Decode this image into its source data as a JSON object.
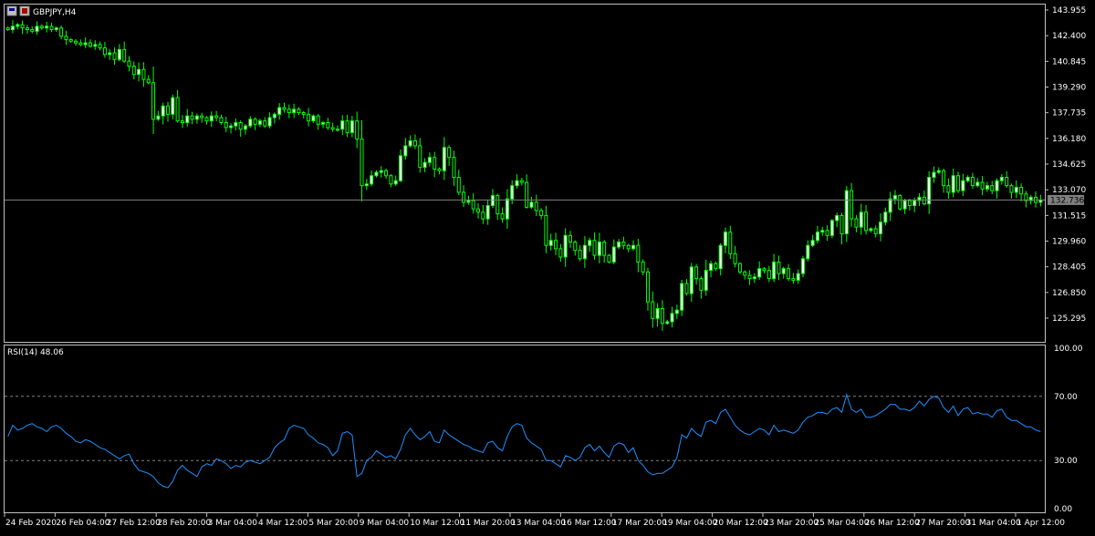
{
  "window": {
    "symbol_label": "GBPJPY,H4",
    "icons": [
      "chart-window-icon",
      "restore-window-icon"
    ]
  },
  "colors": {
    "background": "#000000",
    "frame": "#c0c0c0",
    "bull": "#00ff00",
    "bear": "#ffffff",
    "wick": "#00ff00",
    "rsi_line": "#1e90ff",
    "level_line": "#808080",
    "price_line": "#808080",
    "price_box_bg": "#808080",
    "text": "#ffffff"
  },
  "chart_data": [
    {
      "type": "candlestick",
      "name": "price",
      "title": "GBPJPY,H4",
      "ylim": [
        124.3,
        144.4
      ],
      "price_ticks": [
        "143.955",
        "142.400",
        "140.845",
        "139.290",
        "137.735",
        "136.180",
        "134.625",
        "133.070",
        "131.515",
        "129.960",
        "128.405",
        "126.850",
        "125.295"
      ],
      "current_price": "132.736",
      "current_price_value": 132.736,
      "grid": false,
      "series": [
        {
          "name": "",
          "close": [
            143.0,
            143.2,
            143.3,
            143.1,
            143.0,
            142.9,
            143.2,
            143.1,
            143.2,
            143.0,
            143.1,
            142.6,
            142.4,
            142.3,
            142.2,
            142.1,
            142.2,
            142.0,
            142.1,
            141.9,
            141.5,
            141.6,
            141.2,
            141.8,
            141.1,
            140.8,
            140.3,
            140.6,
            140.0,
            139.8,
            137.6,
            137.8,
            138.4,
            137.9,
            138.9,
            137.5,
            137.4,
            137.8,
            137.6,
            137.8,
            137.7,
            137.5,
            137.8,
            137.7,
            137.4,
            137.1,
            137.2,
            137.4,
            137.0,
            137.2,
            137.6,
            137.3,
            137.5,
            137.2,
            137.7,
            137.9,
            138.3,
            138.2,
            138.0,
            138.2,
            138.0,
            137.9,
            137.5,
            137.8,
            137.3,
            137.4,
            137.1,
            137.0,
            137.0,
            137.5,
            136.8,
            137.5,
            136.4,
            133.6,
            133.7,
            134.2,
            134.4,
            134.5,
            134.2,
            133.7,
            133.9,
            135.4,
            136.0,
            136.3,
            136.0,
            134.7,
            135.0,
            135.3,
            134.6,
            134.5,
            135.9,
            135.3,
            134.1,
            133.2,
            132.6,
            132.7,
            132.2,
            132.0,
            131.6,
            132.4,
            133.0,
            131.9,
            131.6,
            132.8,
            133.6,
            133.9,
            133.8,
            132.3,
            132.6,
            132.1,
            131.8,
            130.0,
            130.3,
            129.8,
            129.3,
            130.6,
            130.2,
            129.7,
            129.2,
            130.0,
            130.3,
            129.4,
            130.2,
            129.4,
            129.0,
            129.9,
            130.2,
            130.0,
            129.8,
            130.0,
            129.0,
            128.4,
            126.6,
            125.6,
            126.2,
            125.3,
            125.4,
            125.9,
            126.1,
            127.7,
            127.1,
            128.7,
            128.0,
            127.3,
            128.5,
            128.9,
            128.6,
            130.0,
            130.8,
            129.5,
            128.9,
            128.4,
            128.2,
            128.0,
            128.1,
            128.6,
            128.5,
            128.0,
            129.0,
            128.3,
            128.6,
            128.0,
            127.9,
            128.3,
            129.2,
            130.0,
            130.3,
            130.8,
            130.9,
            130.6,
            131.5,
            131.8,
            130.7,
            133.3,
            131.6,
            131.1,
            132.0,
            130.9,
            131.0,
            130.7,
            131.4,
            132.0,
            132.8,
            133.0,
            132.2,
            132.7,
            132.4,
            132.7,
            132.9,
            132.5,
            134.1,
            134.4,
            134.5,
            133.6,
            133.2,
            134.2,
            133.3,
            133.9,
            134.1,
            133.6,
            133.8,
            133.4,
            133.6,
            133.3,
            133.9,
            134.1,
            133.6,
            133.2,
            133.5,
            133.1,
            132.7,
            132.9,
            132.6,
            132.74
          ]
        }
      ],
      "note_ohlc": "open/high/low derived in script from close series"
    },
    {
      "type": "line",
      "name": "rsi",
      "title": "RSI(14) 48.06",
      "ylim": [
        0,
        100
      ],
      "y_ticks": [
        "100.00",
        "70.00",
        "30.00",
        "0.00"
      ],
      "levels": [
        70,
        30
      ],
      "series": [
        {
          "name": "RSI(14)",
          "values": [
            45,
            52,
            49,
            50,
            52,
            53,
            51,
            50,
            48,
            51,
            52,
            50,
            47,
            45,
            42,
            41,
            43,
            42,
            40,
            38,
            37,
            35,
            33,
            31,
            33,
            34,
            28,
            24,
            23,
            22,
            20,
            16,
            14,
            13,
            17,
            24,
            27,
            24,
            22,
            20,
            26,
            28,
            27,
            31,
            30,
            28,
            25,
            27,
            26,
            29,
            30,
            29,
            28,
            30,
            32,
            38,
            41,
            43,
            50,
            52,
            51,
            50,
            46,
            44,
            41,
            40,
            38,
            33,
            36,
            47,
            48,
            46,
            20,
            22,
            30,
            32,
            36,
            34,
            32,
            33,
            31,
            37,
            46,
            50,
            46,
            43,
            45,
            48,
            42,
            41,
            49,
            46,
            44,
            42,
            40,
            39,
            37,
            36,
            35,
            41,
            42,
            38,
            36,
            45,
            51,
            53,
            52,
            44,
            41,
            39,
            37,
            30,
            30,
            28,
            26,
            33,
            32,
            30,
            32,
            38,
            40,
            36,
            39,
            35,
            32,
            39,
            41,
            40,
            35,
            38,
            30,
            27,
            23,
            21,
            22,
            22,
            24,
            26,
            32,
            46,
            44,
            50,
            47,
            45,
            54,
            55,
            53,
            60,
            62,
            57,
            52,
            49,
            47,
            46,
            48,
            50,
            49,
            46,
            52,
            48,
            49,
            48,
            47,
            49,
            54,
            57,
            58,
            60,
            60,
            59,
            62,
            63,
            60,
            71,
            62,
            60,
            62,
            57,
            57,
            58,
            60,
            62,
            65,
            65,
            62,
            62,
            61,
            63,
            67,
            64,
            68,
            70,
            69,
            63,
            60,
            64,
            58,
            62,
            63,
            59,
            60,
            59,
            59,
            57,
            61,
            62,
            57,
            55,
            55,
            53,
            51,
            51,
            49,
            48.06
          ]
        }
      ]
    }
  ],
  "time_axis": {
    "labels": [
      "24 Feb 2020",
      "26 Feb 04:00",
      "27 Feb 12:00",
      "28 Feb 20:00",
      "3 Mar 04:00",
      "4 Mar 12:00",
      "5 Mar 20:00",
      "9 Mar 04:00",
      "10 Mar 12:00",
      "11 Mar 20:00",
      "13 Mar 04:00",
      "16 Mar 12:00",
      "17 Mar 20:00",
      "19 Mar 04:00",
      "20 Mar 12:00",
      "23 Mar 20:00",
      "25 Mar 04:00",
      "26 Mar 12:00",
      "27 Mar 20:00",
      "31 Mar 04:00",
      "1 Apr 12:00"
    ]
  }
}
